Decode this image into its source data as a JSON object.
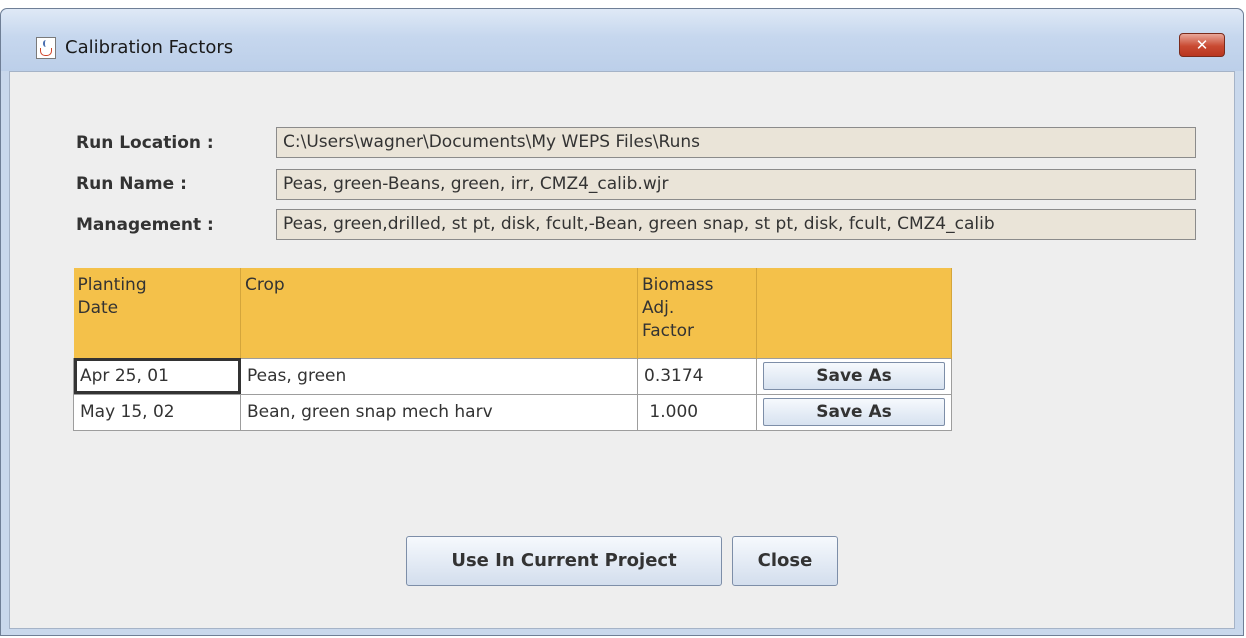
{
  "window": {
    "title": "Calibration Factors",
    "close_glyph": "✕"
  },
  "form": {
    "run_location_label": "Run Location :",
    "run_location_value": "C:\\Users\\wagner\\Documents\\My WEPS Files\\Runs",
    "run_name_label": "Run Name :",
    "run_name_value": "Peas, green-Beans, green, irr, CMZ4_calib.wjr",
    "management_label": "Management :",
    "management_value": "Peas, green,drilled, st pt, disk, fcult,-Bean, green snap, st pt, disk, fcult, CMZ4_calib"
  },
  "table": {
    "headers": {
      "planting_date_line1": "Planting",
      "planting_date_line2": "Date",
      "crop": "Crop",
      "biomass_line1": "Biomass",
      "biomass_line2": "Adj.",
      "biomass_line3": "Factor"
    },
    "rows": [
      {
        "date": "Apr 25, 01",
        "crop": "Peas, green",
        "factor": "0.3174",
        "action": "Save As"
      },
      {
        "date": "May 15, 02",
        "crop": "Bean, green snap mech harv",
        "factor": " 1.000",
        "action": "Save As"
      }
    ]
  },
  "buttons": {
    "use_in_project": "Use In Current Project",
    "close": "Close"
  },
  "colors": {
    "header_bg": "#f4c14a",
    "field_bg": "#eae4d8",
    "title_bar": "#c6d7ee"
  },
  "icons": {
    "window_icon": "java-cup-icon",
    "close_icon": "close-icon"
  }
}
